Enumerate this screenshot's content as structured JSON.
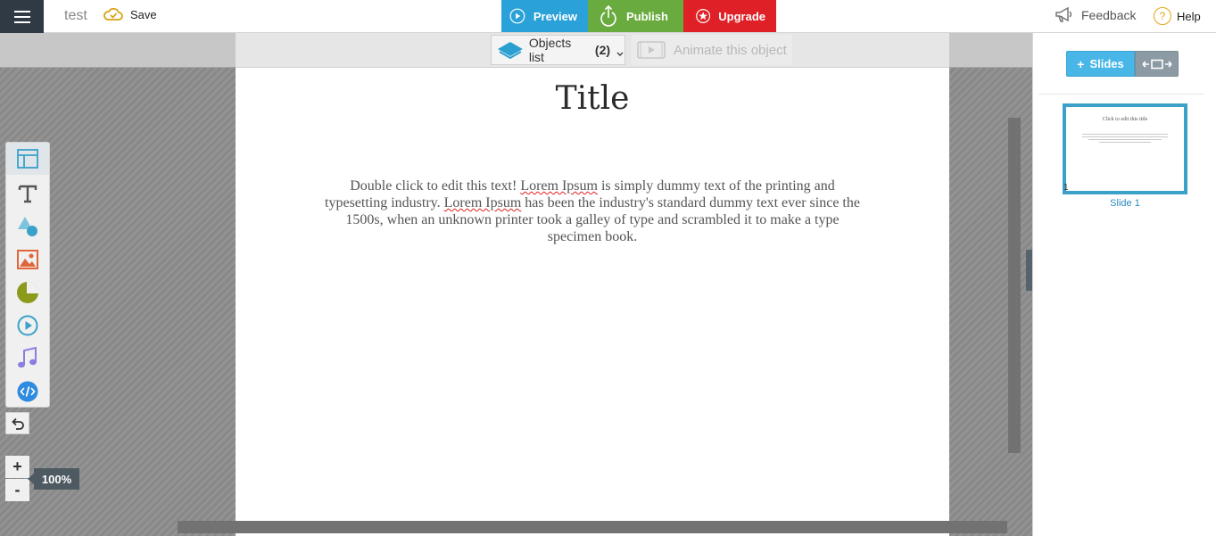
{
  "app": {
    "document_name": "test",
    "save_label": "Save"
  },
  "top_actions": {
    "preview_label": "Preview",
    "publish_label": "Publish",
    "upgrade_label": "Upgrade",
    "feedback_label": "Feedback",
    "help_label": "Help"
  },
  "canvas_toolbar": {
    "objects_list_label": "Objects list",
    "objects_count": "(2)",
    "animate_label": "Animate this object"
  },
  "slide": {
    "title": "Title",
    "body_parts": [
      "Double click to edit this text! ",
      "Lorem Ipsum",
      " is simply dummy text of the printing and typesetting industry. ",
      "Lorem Ipsum",
      " has been the industry's standard dummy text ever since the 1500s, when an unknown printer took a galley of type and scrambled it to make a type specimen book."
    ]
  },
  "left_tools": [
    {
      "name": "layout-icon"
    },
    {
      "name": "text-icon"
    },
    {
      "name": "shapes-icon"
    },
    {
      "name": "image-icon"
    },
    {
      "name": "chart-icon"
    },
    {
      "name": "video-icon"
    },
    {
      "name": "audio-icon"
    },
    {
      "name": "embed-code-icon"
    }
  ],
  "zoom": {
    "plus_label": "+",
    "minus_label": "-",
    "level": "100%"
  },
  "right_panel": {
    "add_slides_label": "Slides",
    "thumbnail_title": "Click to edit this title",
    "thumbnail_number": "1",
    "thumbnail_label": "Slide 1"
  },
  "colors": {
    "preview": "#2aa1d8",
    "publish": "#6aab3f",
    "upgrade": "#df2026",
    "accent": "#48b6e6",
    "menu_bg": "#2f3a45"
  }
}
